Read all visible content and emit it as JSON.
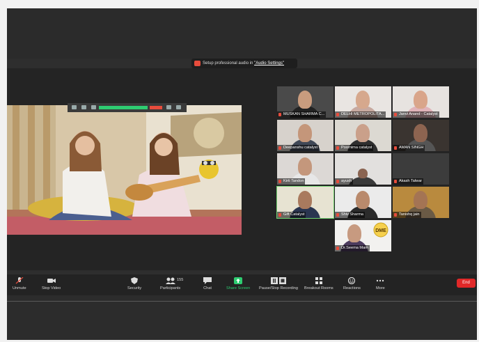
{
  "banner": {
    "text_prefix": "Setup professional audio in ",
    "link": "\"Audio Settings\""
  },
  "tiles": [
    {
      "name": "MUSKAN SHARMA C..."
    },
    {
      "name": "DELHI METROPOLITA..."
    },
    {
      "name": "Janvi Anand - Catalyst"
    },
    {
      "name": "Deepanshu catalyst"
    },
    {
      "name": "Poornima catalyst"
    },
    {
      "name": "AMAN SINGH"
    },
    {
      "name": "Kirti Tandon"
    },
    {
      "name": "ayush"
    },
    {
      "name": "Akash Talwar"
    },
    {
      "name": "Gift Catalyst"
    },
    {
      "name": "Shiv Sharma"
    },
    {
      "name": "Tanishq jain"
    },
    {
      "name": "Dr.Seema Mam"
    }
  ],
  "toolbar": {
    "unmute": "Unmute",
    "stop_video": "Stop Video",
    "security": "Security",
    "participants": "Participants",
    "participants_count": "155",
    "chat": "Chat",
    "share_screen": "Share Screen",
    "recording": "Pause/Stop Recording",
    "breakout": "Breakout Rooms",
    "reactions": "Reactions",
    "more": "More",
    "end": "End"
  },
  "logo_text": "DME",
  "colors": {
    "accent_green": "#2ecc71",
    "end_red": "#e02828",
    "mute_red": "#e74c3c"
  }
}
